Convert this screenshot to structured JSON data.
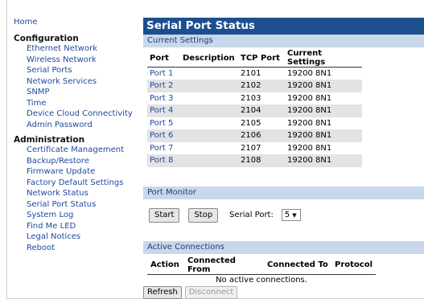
{
  "sidebar": {
    "home": "Home",
    "sections": [
      {
        "title": "Configuration",
        "items": [
          "Ethernet Network",
          "Wireless Network",
          "Serial Ports",
          "Network Services",
          "SNMP",
          "Time",
          "Device Cloud Connectivity",
          "Admin Password"
        ]
      },
      {
        "title": "Administration",
        "items": [
          "Certificate Management",
          "Backup/Restore",
          "Firmware Update",
          "Factory Default Settings",
          "Network Status",
          "Serial Port Status",
          "System Log",
          "Find Me LED",
          "Legal Notices",
          "Reboot"
        ]
      }
    ]
  },
  "main": {
    "title": "Serial Port Status",
    "current_settings": {
      "heading": "Current Settings",
      "columns": [
        "Port",
        "Description",
        "TCP Port",
        "Current Settings"
      ],
      "rows": [
        {
          "port": "Port 1",
          "description": "",
          "tcp": "2101",
          "settings": "19200 8N1"
        },
        {
          "port": "Port 2",
          "description": "",
          "tcp": "2102",
          "settings": "19200 8N1"
        },
        {
          "port": "Port 3",
          "description": "",
          "tcp": "2103",
          "settings": "19200 8N1"
        },
        {
          "port": "Port 4",
          "description": "",
          "tcp": "2104",
          "settings": "19200 8N1"
        },
        {
          "port": "Port 5",
          "description": "",
          "tcp": "2105",
          "settings": "19200 8N1"
        },
        {
          "port": "Port 6",
          "description": "",
          "tcp": "2106",
          "settings": "19200 8N1"
        },
        {
          "port": "Port 7",
          "description": "",
          "tcp": "2107",
          "settings": "19200 8N1"
        },
        {
          "port": "Port 8",
          "description": "",
          "tcp": "2108",
          "settings": "19200 8N1"
        }
      ]
    },
    "port_monitor": {
      "heading": "Port Monitor",
      "start_label": "Start",
      "stop_label": "Stop",
      "serial_port_label": "Serial Port:",
      "serial_port_value": "5"
    },
    "active_connections": {
      "heading": "Active Connections",
      "columns": [
        "Action",
        "Connected From",
        "Connected To",
        "Protocol"
      ],
      "empty_message": "No active connections."
    },
    "buttons": {
      "refresh": "Refresh",
      "disconnect": "Disconnect"
    }
  },
  "colors": {
    "title_bar": "#1d4f8f",
    "panel_header": "#c9d7ea",
    "link": "#1f4a9e",
    "row_stripe": "#e3e3e3"
  }
}
